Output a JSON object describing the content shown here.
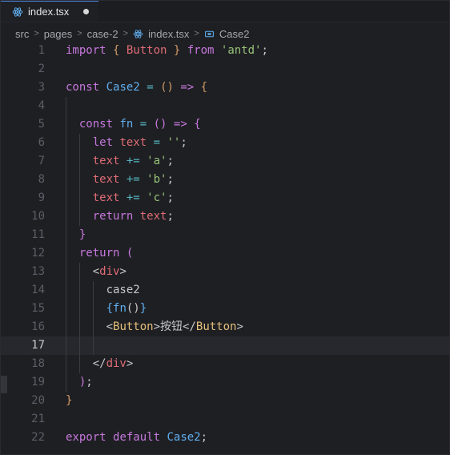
{
  "tab": {
    "filename": "index.tsx"
  },
  "breadcrumb": {
    "src": "src",
    "pages": "pages",
    "folder": "case-2",
    "file": "index.tsx",
    "symbol": "Case2"
  },
  "code_lines": [
    "1",
    "2",
    "3",
    "4",
    "5",
    "6",
    "7",
    "8",
    "9",
    "10",
    "11",
    "12",
    "13",
    "14",
    "15",
    "16",
    "17",
    "18",
    "19",
    "20",
    "21",
    "22"
  ],
  "code": {
    "l1": {
      "import": "import",
      "b1": "{ ",
      "name": "Button",
      "b2": " }",
      "from": "from",
      "str": "'antd'",
      "semi": ";"
    },
    "l3": {
      "const": "const",
      "name": "Case2",
      "eq": "=",
      "paren": "()",
      "arrow": "=>",
      "brace": "{"
    },
    "l5": {
      "const": "const",
      "name": "fn",
      "eq": "=",
      "paren": "()",
      "arrow": "=>",
      "brace": "{"
    },
    "l6": {
      "let": "let",
      "var": "text",
      "eq": "=",
      "str": "''",
      "semi": ";"
    },
    "l7": {
      "var": "text",
      "op": "+=",
      "str": "'a'",
      "semi": ";"
    },
    "l8": {
      "var": "text",
      "op": "+=",
      "str": "'b'",
      "semi": ";"
    },
    "l9": {
      "var": "text",
      "op": "+=",
      "str": "'c'",
      "semi": ";"
    },
    "l10": {
      "return": "return",
      "var": "text",
      "semi": ";"
    },
    "l11": {
      "brace": "}"
    },
    "l12": {
      "return": "return",
      "paren": "("
    },
    "l13": {
      "lt": "<",
      "tag": "div",
      "gt": ">"
    },
    "l14": {
      "text": "case2"
    },
    "l15": {
      "b1": "{",
      "fn": "fn",
      "paren": "()",
      "b2": "}"
    },
    "l16": {
      "lt": "<",
      "tag": "Button",
      "gt": ">",
      "text": "按钮",
      "lt2": "</",
      "tag2": "Button",
      "gt2": ">"
    },
    "l18": {
      "lt": "</",
      "tag": "div",
      "gt": ">"
    },
    "l19": {
      "paren": ")",
      "semi": ";"
    },
    "l20": {
      "brace": "}"
    },
    "l22": {
      "export": "export",
      "default": "default",
      "name": "Case2",
      "semi": ";"
    }
  }
}
